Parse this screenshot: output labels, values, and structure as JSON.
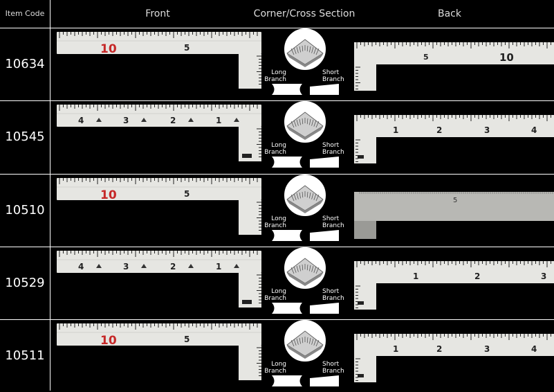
{
  "header": {
    "item_code": "Item Code",
    "front": "Front",
    "corner": "Corner/Cross Section",
    "back": "Back"
  },
  "labels": {
    "long": "Long",
    "branch": "Branch",
    "short": "Short"
  },
  "rows": [
    {
      "code": "10634",
      "front_style": "metric",
      "back_style": "metric",
      "front_nums": [
        "10",
        "5"
      ],
      "back_nums": [
        "5",
        "10"
      ],
      "corner_style": "metric"
    },
    {
      "code": "10545",
      "front_style": "shaku",
      "back_style": "shaku",
      "front_nums": [
        "4",
        "3",
        "2",
        "1"
      ],
      "back_nums": [
        "1",
        "2",
        "3",
        "4"
      ],
      "corner_style": "shaku"
    },
    {
      "code": "10510",
      "front_style": "metric",
      "back_style": "steel",
      "front_nums": [
        "10",
        "5"
      ],
      "back_nums": [
        "5"
      ],
      "corner_style": "metric"
    },
    {
      "code": "10529",
      "front_style": "shaku",
      "back_style": "shaku_sparse",
      "front_nums": [
        "4",
        "3",
        "2",
        "1"
      ],
      "back_nums": [
        "1",
        "2",
        "3"
      ],
      "corner_style": "shaku"
    },
    {
      "code": "10511",
      "front_style": "metric",
      "back_style": "shaku",
      "front_nums": [
        "10",
        "5"
      ],
      "back_nums": [
        "1",
        "2",
        "3",
        "4"
      ],
      "corner_style": "metric"
    }
  ],
  "colors": {
    "highlight_number": "#c62828",
    "ruler": "#e6e6e2",
    "tick": "#222222"
  }
}
